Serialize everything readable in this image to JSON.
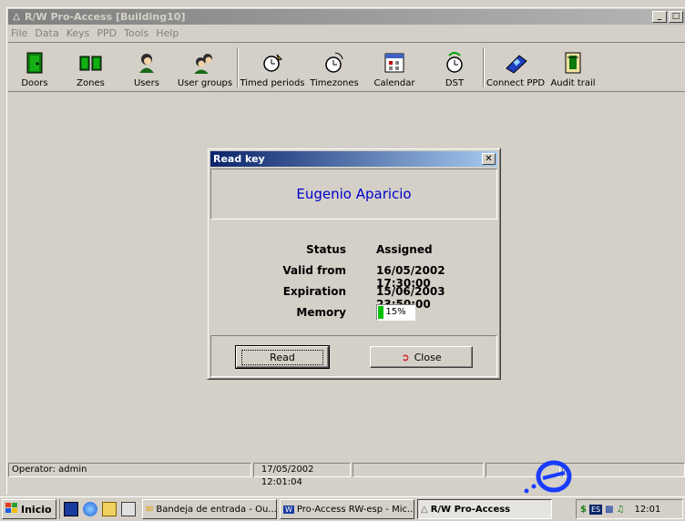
{
  "window": {
    "title": "R/W Pro-Access [Building10]"
  },
  "menu": [
    "File",
    "Data",
    "Keys",
    "PPD",
    "Tools",
    "Help"
  ],
  "toolbar": {
    "doors": "Doors",
    "zones": "Zones",
    "users": "Users",
    "user_groups": "User groups",
    "timed_periods": "Timed periods",
    "timezones": "Timezones",
    "calendar": "Calendar",
    "dst": "DST",
    "connect_ppd": "Connect PPD",
    "audit_trail": "Audit trail"
  },
  "dialog": {
    "title": "Read key",
    "name": "Eugenio Aparicio",
    "status_label": "Status",
    "status_value": "Assigned",
    "valid_from_label": "Valid from",
    "valid_from_value": "16/05/2002 17:30:00",
    "expiration_label": "Expiration",
    "expiration_value": "15/06/2003 23:50:00",
    "memory_label": "Memory",
    "memory_value": "15%",
    "memory_fraction": 0.15,
    "read_button": "Read",
    "close_button": "Close"
  },
  "status": {
    "operator": "Operator: admin",
    "datetime": "17/05/2002 12:01:04"
  },
  "taskbar": {
    "start": "Inicio",
    "items": [
      "Bandeja de entrada - Ou...",
      "Pro-Access RW-esp - Mic...",
      "R/W Pro-Access"
    ],
    "lang": "ES",
    "clock": "12:01"
  },
  "colors": {
    "name_text": "#0000cc",
    "dialog_title": "#0a246a",
    "memory_fill": "#00c000"
  }
}
